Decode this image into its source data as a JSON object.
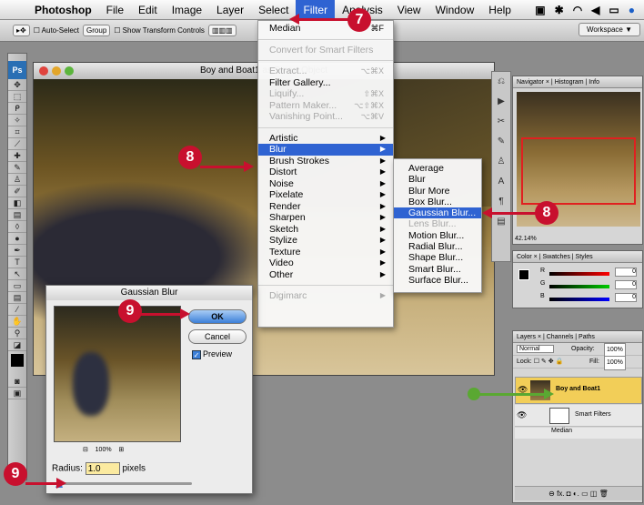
{
  "menubar": {
    "app": "Photoshop",
    "items": [
      "File",
      "Edit",
      "Image",
      "Layer",
      "Select",
      "Filter",
      "Analysis",
      "View",
      "Window",
      "Help"
    ],
    "active": "Filter"
  },
  "optbar": {
    "auto_select": "Auto-Select",
    "group": "Group",
    "show_transform": "Show Transform Controls",
    "workspace": "Workspace ▼"
  },
  "toolbox": {
    "logo": "Ps"
  },
  "document": {
    "title": "Boy and Boat1 as Smart Object"
  },
  "filter_menu": {
    "last_filter": {
      "label": "Median",
      "shortcut": "⌘F"
    },
    "convert": "Convert for Smart Filters",
    "group2": [
      {
        "label": "Extract...",
        "shortcut": "⌥⌘X",
        "disabled": true
      },
      {
        "label": "Filter Gallery...",
        "shortcut": "",
        "disabled": false
      },
      {
        "label": "Liquify...",
        "shortcut": "⇧⌘X",
        "disabled": true
      },
      {
        "label": "Pattern Maker...",
        "shortcut": "⌥⇧⌘X",
        "disabled": true
      },
      {
        "label": "Vanishing Point...",
        "shortcut": "⌥⌘V",
        "disabled": true
      }
    ],
    "submenus": [
      "Artistic",
      "Blur",
      "Brush Strokes",
      "Distort",
      "Noise",
      "Pixelate",
      "Render",
      "Sharpen",
      "Sketch",
      "Stylize",
      "Texture",
      "Video",
      "Other"
    ],
    "selected": "Blur",
    "digimarc": "Digimarc"
  },
  "blur_submenu": {
    "items": [
      {
        "label": "Average",
        "disabled": false
      },
      {
        "label": "Blur",
        "disabled": false
      },
      {
        "label": "Blur More",
        "disabled": false
      },
      {
        "label": "Box Blur...",
        "disabled": false
      },
      {
        "label": "Gaussian Blur...",
        "disabled": false
      },
      {
        "label": "Lens Blur...",
        "disabled": true
      },
      {
        "label": "Motion Blur...",
        "disabled": false
      },
      {
        "label": "Radial Blur...",
        "disabled": false
      },
      {
        "label": "Shape Blur...",
        "disabled": false
      },
      {
        "label": "Smart Blur...",
        "disabled": false
      },
      {
        "label": "Surface Blur...",
        "disabled": false
      }
    ],
    "selected": "Gaussian Blur..."
  },
  "navigator": {
    "tabs": "Navigator × | Histogram | Info",
    "zoom": "42.14%"
  },
  "color_panel": {
    "tabs": "Color × | Swatches | Styles",
    "values": [
      "0",
      "0",
      "0"
    ],
    "labels": [
      "R",
      "G",
      "B"
    ]
  },
  "layers_panel": {
    "tabs": "Layers × | Channels | Paths",
    "blend": "Normal",
    "opacity_label": "Opacity:",
    "opacity": "100%",
    "lock_label": "Lock:",
    "fill_label": "Fill:",
    "fill": "100%",
    "layer_name": "Boy and Boat1",
    "smart_filters": "Smart Filters",
    "median": "Median",
    "footer": "⊖ fx. ◘ ◐. ▭ ◫ 🗑"
  },
  "gaussian_dialog": {
    "title": "Gaussian Blur",
    "ok": "OK",
    "cancel": "Cancel",
    "preview": "Preview",
    "zoom": "100%",
    "radius_label": "Radius:",
    "radius_value": "1.0",
    "radius_unit": "pixels"
  },
  "callouts": {
    "seven": "7",
    "eight": "8",
    "nine": "9"
  }
}
